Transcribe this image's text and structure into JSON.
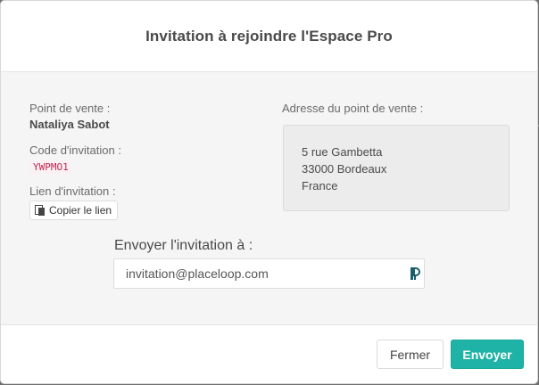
{
  "modal": {
    "title": "Invitation à rejoindre l'Espace Pro"
  },
  "store": {
    "label": "Point de vente :",
    "name": "Nataliya Sabot"
  },
  "invitation_code": {
    "label": "Code d'invitation :",
    "value": "YWPMO1"
  },
  "invitation_link": {
    "label": "Lien d'invitation :",
    "copy_label": "Copier le lien"
  },
  "address": {
    "label": "Adresse du point de vente :",
    "line1": "5 rue Gambetta",
    "line2": "33000 Bordeaux",
    "line3": "France"
  },
  "send_to": {
    "label": "Envoyer l'invitation à :",
    "email_value": "invitation@placeloop.com"
  },
  "footer": {
    "close_label": "Fermer",
    "send_label": "Envoyer"
  },
  "colors": {
    "accent": "#1eb3a6",
    "code_text": "#c7254e"
  }
}
